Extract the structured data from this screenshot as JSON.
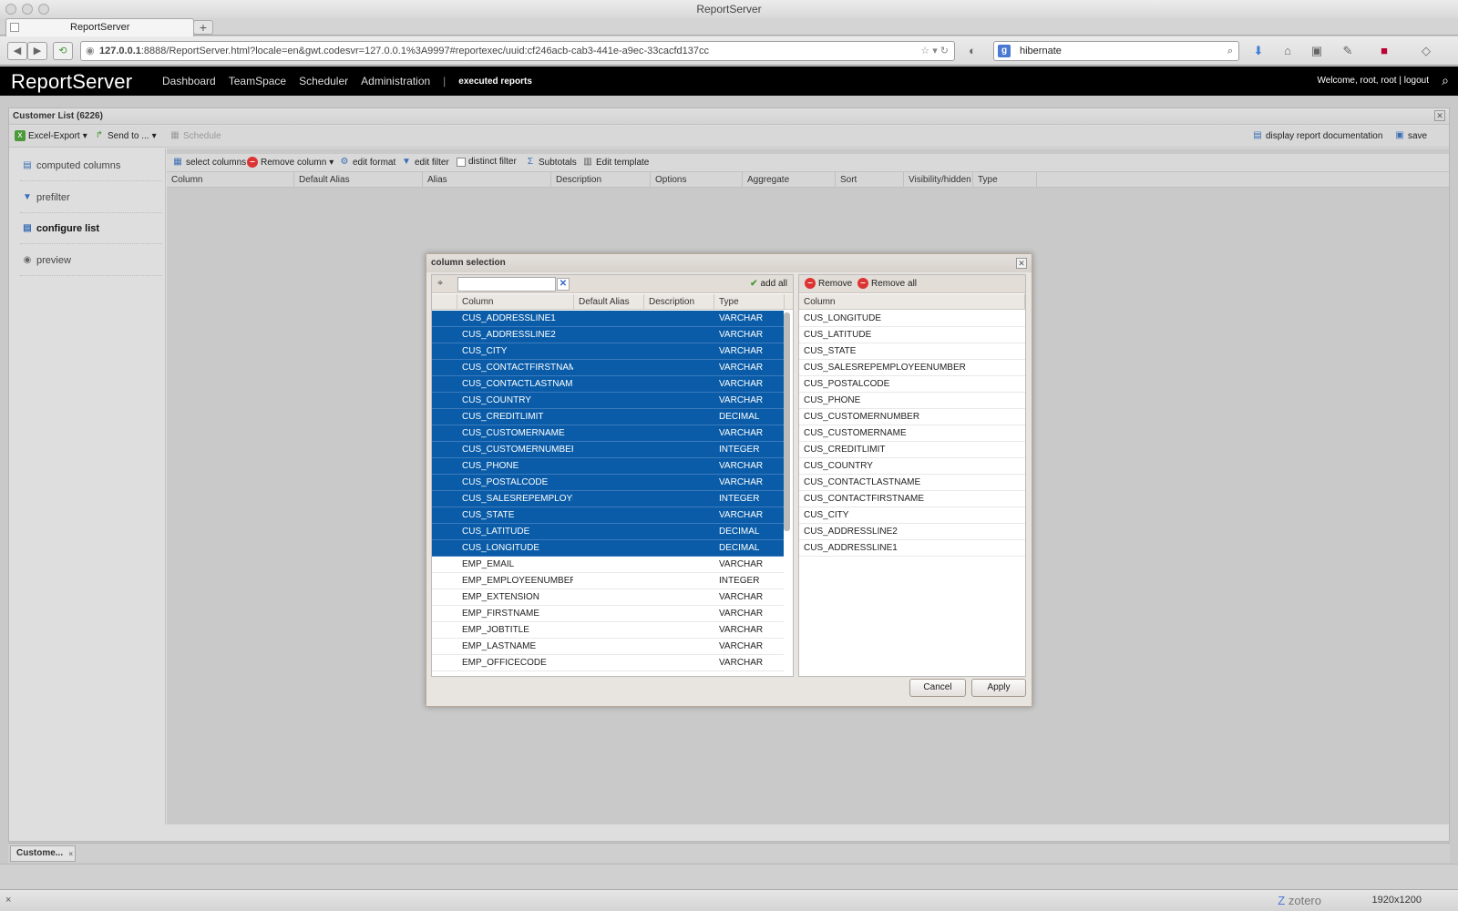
{
  "browser": {
    "window_title": "ReportServer",
    "tab_title": "ReportServer",
    "new_tab": "+",
    "url_host": "127.0.0.1",
    "url_rest": ":8888/ReportServer.html?locale=en&gwt.codesvr=127.0.0.1%3A9997#reportexec/uuid:cf246acb-cab3-441e-a9ec-33cacfd137cc",
    "search_value": "hibernate",
    "search_engine_icon": "g-icon"
  },
  "app": {
    "brand_bold": "Report",
    "brand_light": "Server",
    "nav": [
      "Dashboard",
      "TeamSpace",
      "Scheduler",
      "Administration"
    ],
    "nav_separator": "|",
    "active_section": "executed reports",
    "welcome": "Welcome, root, root",
    "welcome_sep": "|",
    "logout": "logout"
  },
  "report": {
    "title": "Customer List (6226)",
    "toolbar": {
      "excel_export": "Excel-Export",
      "send_to": "Send to ...",
      "schedule": "Schedule",
      "display_doc": "display report documentation",
      "save": "save"
    },
    "left_nav": [
      "computed columns",
      "prefilter",
      "configure list",
      "preview"
    ],
    "main_toolbar": {
      "select_columns": "select columns",
      "remove_column": "Remove column",
      "edit_format": "edit format",
      "edit_filter": "edit filter",
      "distinct_filter": "distinct filter",
      "subtotals": "Subtotals",
      "edit_template": "Edit template"
    },
    "main_headers": [
      "Column",
      "Default Alias",
      "Alias",
      "Description",
      "Options",
      "Aggregate",
      "Sort",
      "Visibility/hidden",
      "Type"
    ]
  },
  "dialog": {
    "title": "column selection",
    "search_placeholder": "",
    "add_all": "add all",
    "remove": "Remove",
    "remove_all": "Remove all",
    "left_headers": [
      "Column",
      "Default Alias",
      "Description",
      "Type"
    ],
    "right_header": "Column",
    "cancel": "Cancel",
    "apply": "Apply",
    "available_columns": [
      {
        "column": "CUS_ADDRESSLINE1",
        "type": "VARCHAR",
        "selected": true
      },
      {
        "column": "CUS_ADDRESSLINE2",
        "type": "VARCHAR",
        "selected": true
      },
      {
        "column": "CUS_CITY",
        "type": "VARCHAR",
        "selected": true
      },
      {
        "column": "CUS_CONTACTFIRSTNAME",
        "type": "VARCHAR",
        "selected": true
      },
      {
        "column": "CUS_CONTACTLASTNAME",
        "type": "VARCHAR",
        "selected": true
      },
      {
        "column": "CUS_COUNTRY",
        "type": "VARCHAR",
        "selected": true
      },
      {
        "column": "CUS_CREDITLIMIT",
        "type": "DECIMAL",
        "selected": true
      },
      {
        "column": "CUS_CUSTOMERNAME",
        "type": "VARCHAR",
        "selected": true
      },
      {
        "column": "CUS_CUSTOMERNUMBER",
        "type": "INTEGER",
        "selected": true
      },
      {
        "column": "CUS_PHONE",
        "type": "VARCHAR",
        "selected": true
      },
      {
        "column": "CUS_POSTALCODE",
        "type": "VARCHAR",
        "selected": true
      },
      {
        "column": "CUS_SALESREPEMPLOYEEN...",
        "type": "INTEGER",
        "selected": true
      },
      {
        "column": "CUS_STATE",
        "type": "VARCHAR",
        "selected": true
      },
      {
        "column": "CUS_LATITUDE",
        "type": "DECIMAL",
        "selected": true
      },
      {
        "column": "CUS_LONGITUDE",
        "type": "DECIMAL",
        "selected": true
      },
      {
        "column": "EMP_EMAIL",
        "type": "VARCHAR",
        "selected": false
      },
      {
        "column": "EMP_EMPLOYEENUMBER",
        "type": "INTEGER",
        "selected": false
      },
      {
        "column": "EMP_EXTENSION",
        "type": "VARCHAR",
        "selected": false
      },
      {
        "column": "EMP_FIRSTNAME",
        "type": "VARCHAR",
        "selected": false
      },
      {
        "column": "EMP_JOBTITLE",
        "type": "VARCHAR",
        "selected": false
      },
      {
        "column": "EMP_LASTNAME",
        "type": "VARCHAR",
        "selected": false
      },
      {
        "column": "EMP_OFFICECODE",
        "type": "VARCHAR",
        "selected": false
      }
    ],
    "selected_columns": [
      "CUS_LONGITUDE",
      "CUS_LATITUDE",
      "CUS_STATE",
      "CUS_SALESREPEMPLOYEENUMBER",
      "CUS_POSTALCODE",
      "CUS_PHONE",
      "CUS_CUSTOMERNUMBER",
      "CUS_CUSTOMERNAME",
      "CUS_CREDITLIMIT",
      "CUS_COUNTRY",
      "CUS_CONTACTLASTNAME",
      "CUS_CONTACTFIRSTNAME",
      "CUS_CITY",
      "CUS_ADDRESSLINE2",
      "CUS_ADDRESSLINE1"
    ]
  },
  "bottom": {
    "tab_label": "Custome...",
    "tab_close": "×"
  },
  "status": {
    "close": "×",
    "zotero": "zotero",
    "resolution": "1920x1200"
  },
  "colors": {
    "selection": "#0a5ca8",
    "header_bg": "#000000"
  }
}
